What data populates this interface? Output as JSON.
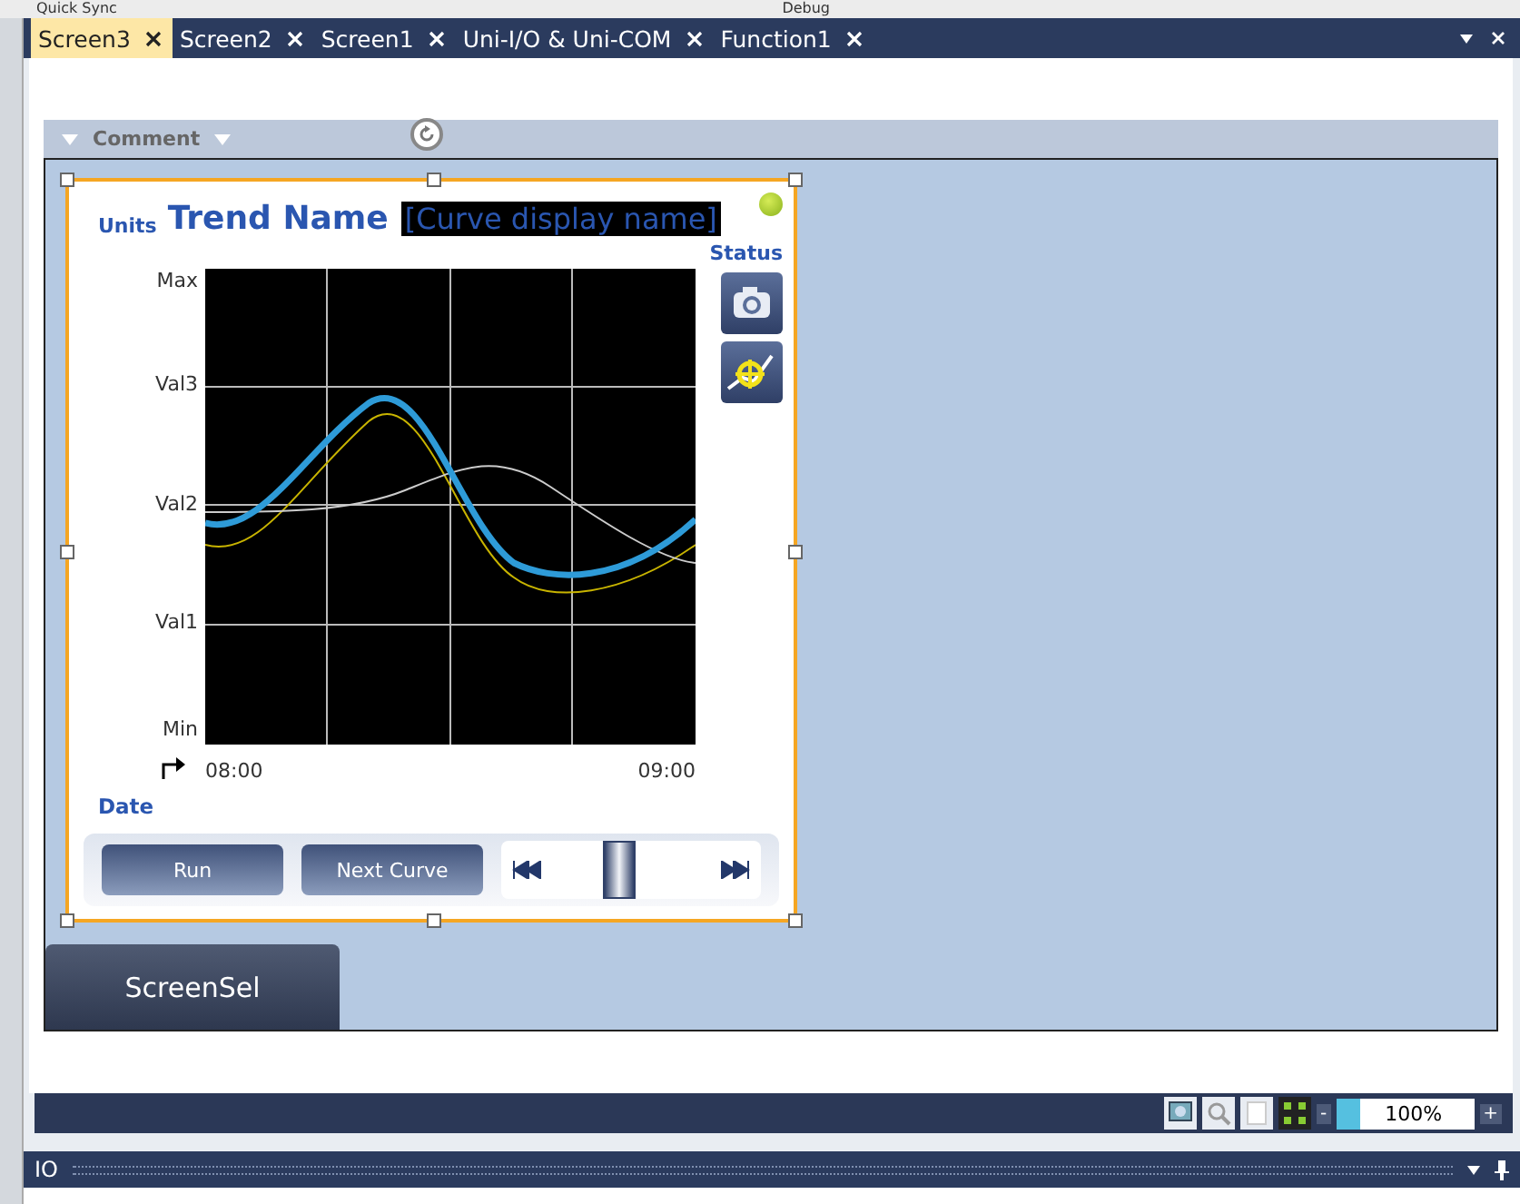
{
  "menu_strip": [
    "Quick Sync",
    "Debug"
  ],
  "tabs": [
    {
      "label": "Screen3",
      "selected": true
    },
    {
      "label": "Screen2",
      "selected": false
    },
    {
      "label": "Screen1",
      "selected": false
    },
    {
      "label": "Uni-I/O & Uni-COM",
      "selected": false
    },
    {
      "label": "Function1",
      "selected": false
    }
  ],
  "comment_bar": {
    "label": "Comment"
  },
  "trend": {
    "title": "Trend Name",
    "curve_name": "[Curve display name]",
    "units_label": "Units",
    "status_label": "Status",
    "status_on": true,
    "y_labels": [
      "Max",
      "Val3",
      "Val2",
      "Val1",
      "Min"
    ],
    "x_labels": [
      "08:00",
      "09:00"
    ],
    "date_label": "Date",
    "buttons": [
      "Run",
      "Next Curve"
    ],
    "scroll": {
      "level": 0.45
    }
  },
  "screen_button": "ScreenSel",
  "zoom": {
    "minus": "-",
    "value": "100%",
    "plus": "+"
  },
  "io_panel": {
    "title": "IO"
  }
}
